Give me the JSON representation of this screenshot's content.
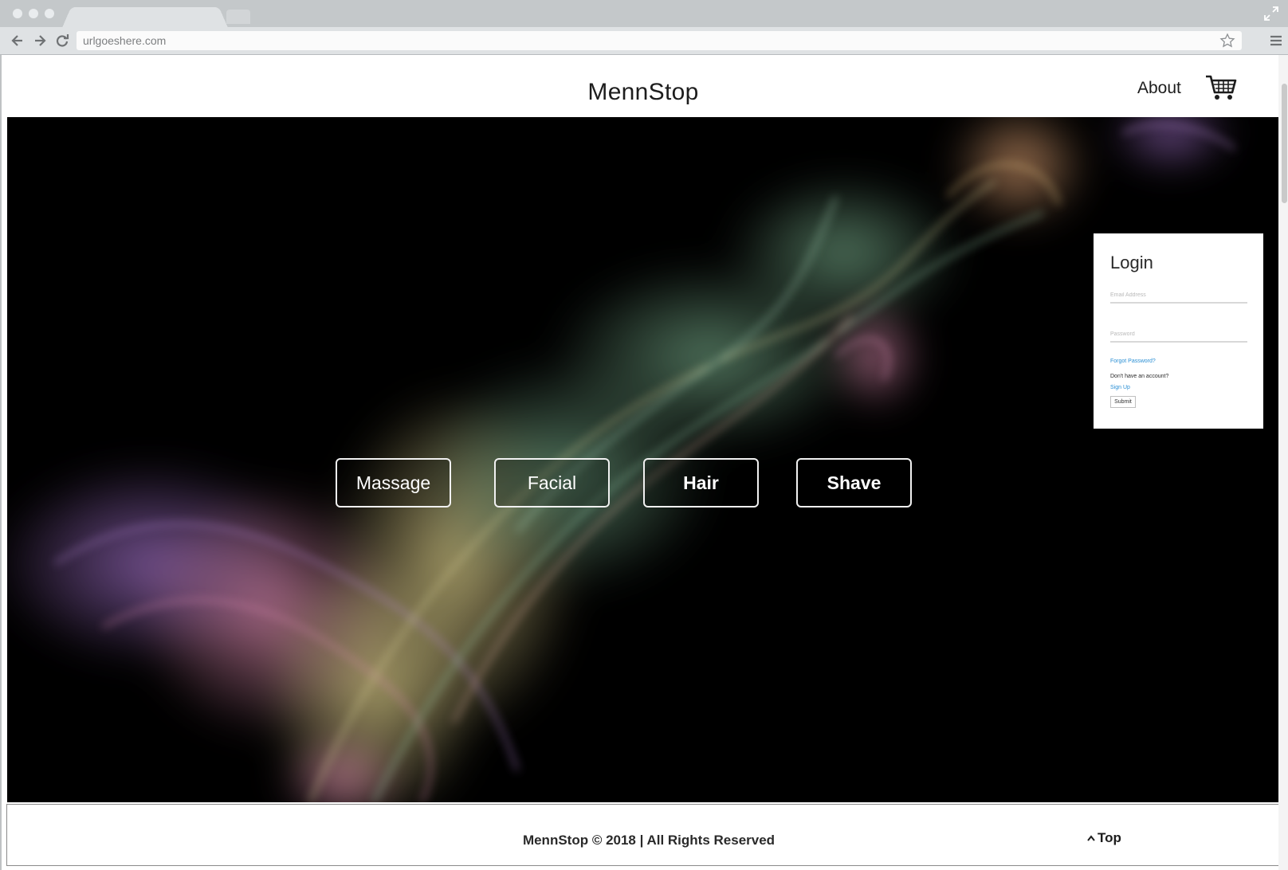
{
  "browser": {
    "url": "urlgoeshere.com"
  },
  "header": {
    "site_title": "MennStop",
    "about_label": "About"
  },
  "services": [
    {
      "label": "Massage"
    },
    {
      "label": "Facial"
    },
    {
      "label": "Hair"
    },
    {
      "label": "Shave"
    }
  ],
  "login": {
    "title": "Login",
    "email_placeholder": "Email Address",
    "password_placeholder": "Password",
    "forgot_label": "Forgot Password?",
    "no_account_label": "Don't have an account?",
    "signup_label": "Sign Up",
    "submit_label": "Submit"
  },
  "footer": {
    "copyright": "MennStop  © 2018  |  All Rights Reserved",
    "top_label": "Top"
  },
  "colors": {
    "link": "#2a8fd4",
    "hero_background": "#000000"
  },
  "icons": [
    "back-icon",
    "forward-icon",
    "reload-icon",
    "star-icon",
    "menu-icon",
    "expand-icon",
    "cart-icon",
    "caret-up-icon"
  ]
}
